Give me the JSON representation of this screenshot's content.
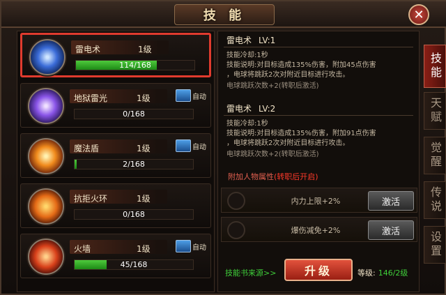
{
  "window": {
    "title": "技 能",
    "close_label": "✕"
  },
  "skills": [
    {
      "name": "雷电术",
      "level": "1级",
      "progress_text": "114/168",
      "progress": 0.68,
      "auto": false,
      "icon": "lightning-orb-icon",
      "selected": true
    },
    {
      "name": "地狱雷光",
      "level": "1级",
      "progress_text": "0/168",
      "progress": 0.0,
      "auto": true,
      "auto_label": "自动",
      "icon": "hell-lightning-orb-icon"
    },
    {
      "name": "魔法盾",
      "level": "1级",
      "progress_text": "2/168",
      "progress": 0.012,
      "auto": true,
      "auto_label": "自动",
      "icon": "magic-shield-orb-icon"
    },
    {
      "name": "抗拒火环",
      "level": "1级",
      "progress_text": "0/168",
      "progress": 0.0,
      "auto": false,
      "icon": "fire-ring-orb-icon"
    },
    {
      "name": "火墙",
      "level": "1级",
      "progress_text": "45/168",
      "progress": 0.27,
      "auto": true,
      "auto_label": "自动",
      "icon": "fire-wall-orb-icon"
    }
  ],
  "detail": {
    "current": {
      "name": "雷电术",
      "lv": "LV:1",
      "cooldown": "技能冷却:1秒",
      "desc1": "技能说明:对目标造成135%伤害，附加45点伤害",
      "desc2": "，电球将跳跃2次对附近目标进行攻击。",
      "extra": "电球跳跃次数+2(转职后激活)"
    },
    "next": {
      "name": "雷电术",
      "lv": "LV:2",
      "cooldown": "技能冷却:1秒",
      "desc1": "技能说明:对目标造成135%伤害，附加91点伤害",
      "desc2": "，电球将跳跃2次对附近目标进行攻击。",
      "extra": "电球跳跃次数+2(转职后激活)"
    },
    "attr_title": "附加人物属性",
    "attr_title_note": "(转职后开启)",
    "attributes": [
      {
        "text": "内力上限+2%",
        "button": "激活"
      },
      {
        "text": "爆伤减免+2%",
        "button": "激活"
      }
    ],
    "source_link": "技能书来源>>",
    "upgrade_label": "升级",
    "grade_label": "等级:",
    "grade_value": "146/2级"
  },
  "tabs": [
    {
      "label": "技能",
      "active": true
    },
    {
      "label": "天赋",
      "active": false
    },
    {
      "label": "觉醒",
      "active": false
    },
    {
      "label": "传说",
      "active": false
    },
    {
      "label": "设置",
      "active": false
    }
  ],
  "colors": {
    "accent_red": "#e03b2e",
    "progress_green": "#3fcf3a",
    "auto_blue": "#2f7fd0"
  }
}
